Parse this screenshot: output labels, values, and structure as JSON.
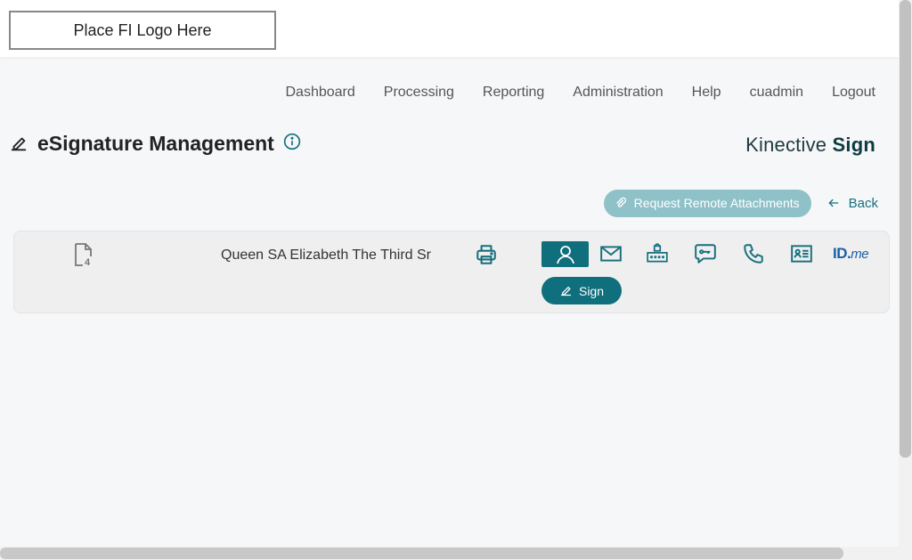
{
  "header": {
    "logo_placeholder": "Place FI Logo Here"
  },
  "nav": {
    "items": [
      "Dashboard",
      "Processing",
      "Reporting",
      "Administration",
      "Help",
      "cuadmin",
      "Logout"
    ]
  },
  "page": {
    "title": "eSignature Management",
    "brand_light": "Kinective ",
    "brand_bold": "Sign"
  },
  "actions": {
    "request_remote_attachments": "Request Remote Attachments",
    "back": "Back"
  },
  "signer": {
    "name": "Queen SA Elizabeth The Third Sr",
    "sign_label": "Sign",
    "idme_label": "ID.",
    "idme_suffix": "me",
    "document_count_icon": "document-4-icon"
  },
  "colors": {
    "accent": "#0f6f7c",
    "accent_light": "#8fc1c9",
    "idme_blue": "#1b5fa8"
  }
}
